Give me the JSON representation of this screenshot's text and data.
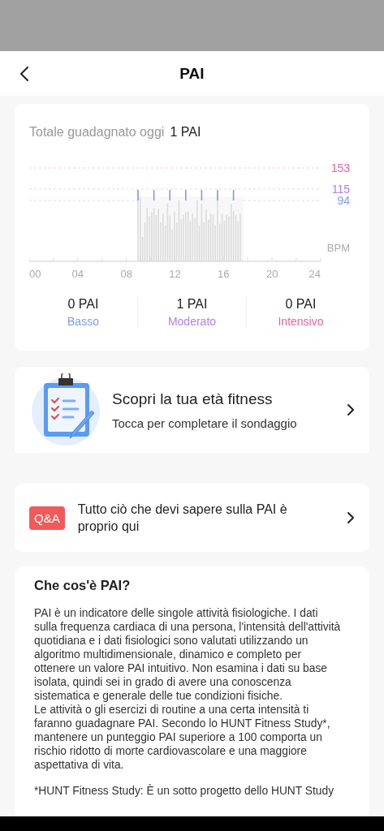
{
  "header": {
    "title": "PAI"
  },
  "summary": {
    "label": "Totale guadagnato oggi",
    "value": "1 PAI"
  },
  "chart": {
    "markers": [
      {
        "label": "153",
        "color": "#f0609a"
      },
      {
        "label": "115",
        "color": "#b57cf0"
      },
      {
        "label": "94",
        "color": "#7c9cf5"
      }
    ],
    "unit": "BPM",
    "x_labels": [
      "00",
      "04",
      "08",
      "12",
      "16",
      "20",
      "24"
    ]
  },
  "zones": [
    {
      "value": "0 PAI",
      "label": "Basso",
      "color": "#7c9cf5"
    },
    {
      "value": "1 PAI",
      "label": "Moderato",
      "color": "#b57cf0"
    },
    {
      "value": "0 PAI",
      "label": "Intensivo",
      "color": "#f0609a"
    }
  ],
  "promo": {
    "title": "Scopri la tua età fitness",
    "subtitle": "Tocca per completare il sondaggio"
  },
  "qa": {
    "badge": "Q&A",
    "text": "Tutto ciò che devi sapere sulla PAI è proprio qui"
  },
  "info": {
    "title": "Che cos'è PAI?",
    "paragraphs": [
      "PAI è un indicatore delle singole attività fisiologiche. I dati sulla frequenza cardiaca di una persona, l'intensità dell'attività quotidiana e i dati fisiologici sono valutati utilizzando un algoritmo multidimensionale, dinamico e completo per ottenere un valore PAI intuitivo. Non esamina i dati su base isolata, quindi sei in grado di avere una conoscenza sistematica e generale delle tue condizioni fisiche.",
      "Le attività o gli esercizi di routine a una certa intensità ti faranno guadagnare PAI. Secondo lo HUNT Fitness Study*, mantenere un punteggio PAI superiore a 100 comporta un rischio ridotto di morte cardiovascolare e una maggiore aspettativa di vita.",
      "*HUNT Fitness Study: È un sotto progetto dello HUNT Study"
    ]
  }
}
